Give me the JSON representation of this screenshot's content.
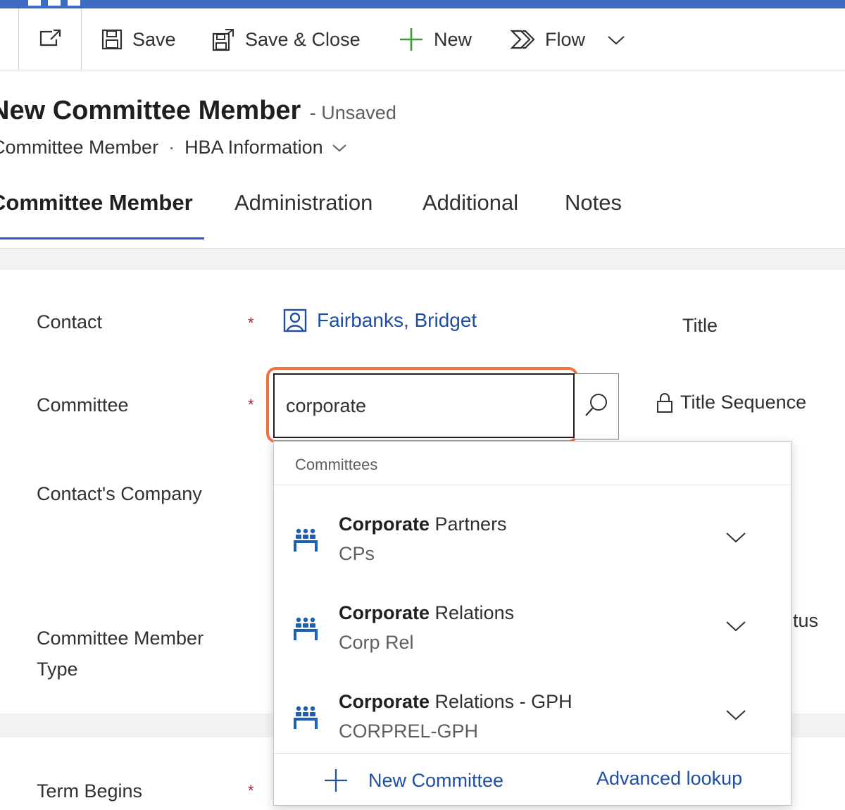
{
  "toolbar": {
    "save_label": "Save",
    "save_close_label": "Save & Close",
    "new_label": "New",
    "flow_label": "Flow"
  },
  "header": {
    "title": "New Committee Member",
    "status": "- Unsaved",
    "entity": "Committee Member",
    "form_name": "HBA Information"
  },
  "tabs": [
    {
      "label": "Committee Member"
    },
    {
      "label": "Administration"
    },
    {
      "label": "Additional"
    },
    {
      "label": "Notes"
    }
  ],
  "form": {
    "contact_label": "Contact",
    "contact_value": "Fairbanks, Bridget",
    "committee_label": "Committee",
    "committee_search_value": "corporate",
    "contacts_company_label": "Contact's Company",
    "member_type_label_line1": "Committee Member",
    "member_type_label_line2": "Type",
    "term_begins_label": "Term Begins",
    "title_label": "Title",
    "title_sequence_label": "Title Sequence",
    "partial_status_label": "tus",
    "required_marker": "*"
  },
  "lookup_dropdown": {
    "header": "Committees",
    "match_text": "Corporate",
    "results": [
      {
        "rest": " Partners",
        "code": "CPs"
      },
      {
        "rest": " Relations",
        "code": "Corp Rel"
      },
      {
        "rest": " Relations - GPH",
        "code": "CORPREL-GPH"
      }
    ],
    "new_label": "New Committee",
    "advanced_label": "Advanced lookup"
  },
  "colors": {
    "accent": "#2b59c3",
    "link": "#1e4fa3",
    "focus_outline": "#ef7140",
    "required": "#a4262c"
  },
  "icons": {
    "popout": "popout-icon",
    "save": "save-icon",
    "save_close": "save-close-icon",
    "new": "plus-icon",
    "flow": "flow-icon",
    "contact": "contact-icon",
    "search": "search-icon",
    "lock": "lock-icon",
    "committee": "committee-icon",
    "chevron": "chevron-down-icon"
  }
}
